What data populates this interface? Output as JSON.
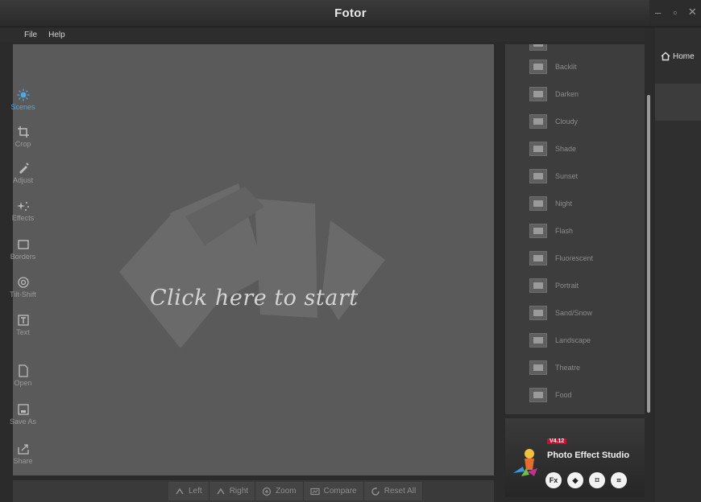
{
  "app": {
    "title": "Fotor"
  },
  "window": {
    "minimize": "–",
    "maximize": "▫",
    "close": "✕"
  },
  "menu": {
    "file": "File",
    "help": "Help"
  },
  "canvas": {
    "start_text": "Click here to start"
  },
  "bottom_toolbar": {
    "left": "Left",
    "right": "Right",
    "zoom": "Zoom",
    "compare": "Compare",
    "reset_all": "Reset All"
  },
  "scenes": [
    {
      "label": "Backlit"
    },
    {
      "label": "Darken"
    },
    {
      "label": "Cloudy"
    },
    {
      "label": "Shade"
    },
    {
      "label": "Sunset"
    },
    {
      "label": "Night"
    },
    {
      "label": "Flash"
    },
    {
      "label": "Fluorescent"
    },
    {
      "label": "Portrait"
    },
    {
      "label": "Sand/Snow"
    },
    {
      "label": "Landscape"
    },
    {
      "label": "Theatre"
    },
    {
      "label": "Food"
    }
  ],
  "promo": {
    "badge": "V4.12",
    "title": "Photo Effect Studio",
    "icons": [
      "Fx",
      "◆",
      "⌑",
      "⌗"
    ]
  },
  "nav": {
    "home": "Home",
    "scenes": "Scenes",
    "crop": "Crop",
    "adjust": "Adjust",
    "effects": "Effects",
    "borders": "Borders",
    "tilt_shift": "Tilt-Shift",
    "text": "Text",
    "open": "Open",
    "save_as": "Save As",
    "share": "Share"
  },
  "colors": {
    "canvas_bg": "#5a5a5a",
    "active_nav": "#4fa8e0",
    "promo_badge": "#c8102e"
  }
}
